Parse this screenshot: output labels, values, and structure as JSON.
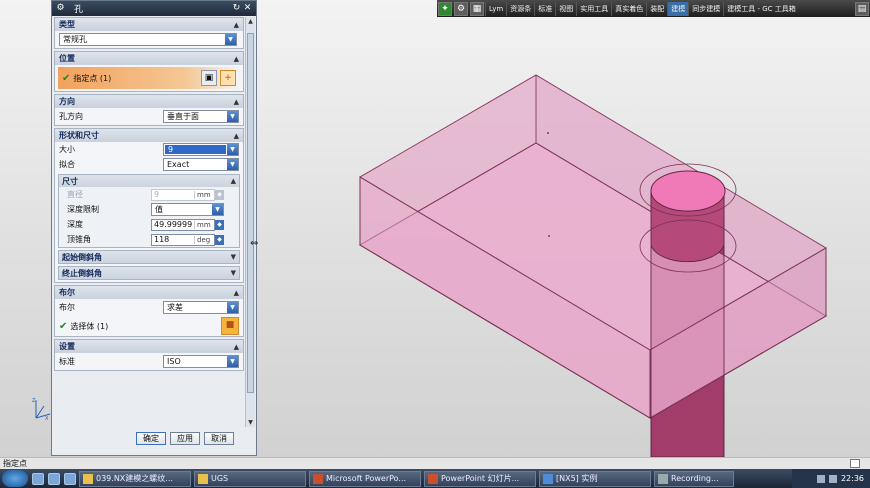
{
  "toolbar": {
    "items": [
      "Lym",
      "资源条",
      "标准",
      "视图",
      "实用工具",
      "真实着色",
      "装配",
      "建模",
      "同步建模",
      "建模工具 - GC 工具箱"
    ],
    "active_index": 7
  },
  "dialog": {
    "title": "孔",
    "sections": {
      "type": {
        "label": "类型",
        "value": "常规孔"
      },
      "position": {
        "label": "位置",
        "point_label": "指定点 (1)"
      },
      "direction": {
        "label": "方向",
        "field_label": "孔方向",
        "value": "垂直于面"
      },
      "form": {
        "label": "形状和尺寸",
        "size_label": "大小",
        "size_value": "9",
        "fit_label": "拟合",
        "fit_value": "Exact",
        "dimensions": {
          "label": "尺寸",
          "diameter_label": "直径",
          "diameter_value": "9",
          "diameter_unit": "mm",
          "depth_limit_label": "深度限制",
          "depth_limit_value": "值",
          "depth_label": "深度",
          "depth_value": "49.99999",
          "depth_unit": "mm",
          "tip_angle_label": "顶锥角",
          "tip_angle_value": "118",
          "tip_angle_unit": "deg"
        },
        "start_chamfer": "起始倒斜角",
        "end_chamfer": "终止倒斜角"
      },
      "boolean": {
        "label": "布尔",
        "field_label": "布尔",
        "value": "求差",
        "body_label": "选择体 (1)"
      },
      "settings": {
        "label": "设置",
        "standard_label": "标准",
        "standard_value": "ISO"
      }
    },
    "buttons": {
      "ok": "确定",
      "apply": "应用",
      "cancel": "取消"
    }
  },
  "statusbar": {
    "text": "指定点"
  },
  "taskbar": {
    "tasks": [
      "039.NX建模之螺纹...",
      "UGS",
      "Microsoft PowerPo...",
      "PowerPoint 幻灯片...",
      "[NX5] 实例",
      "Recording..."
    ],
    "clock": "22:36"
  },
  "colors": {
    "block_fill": "#e7a5c9",
    "block_edge": "#7a2f55",
    "cylinder_fill": "#a13d68",
    "cylinder_top": "#f07ab8",
    "accent_orange": "#f2a25c"
  }
}
